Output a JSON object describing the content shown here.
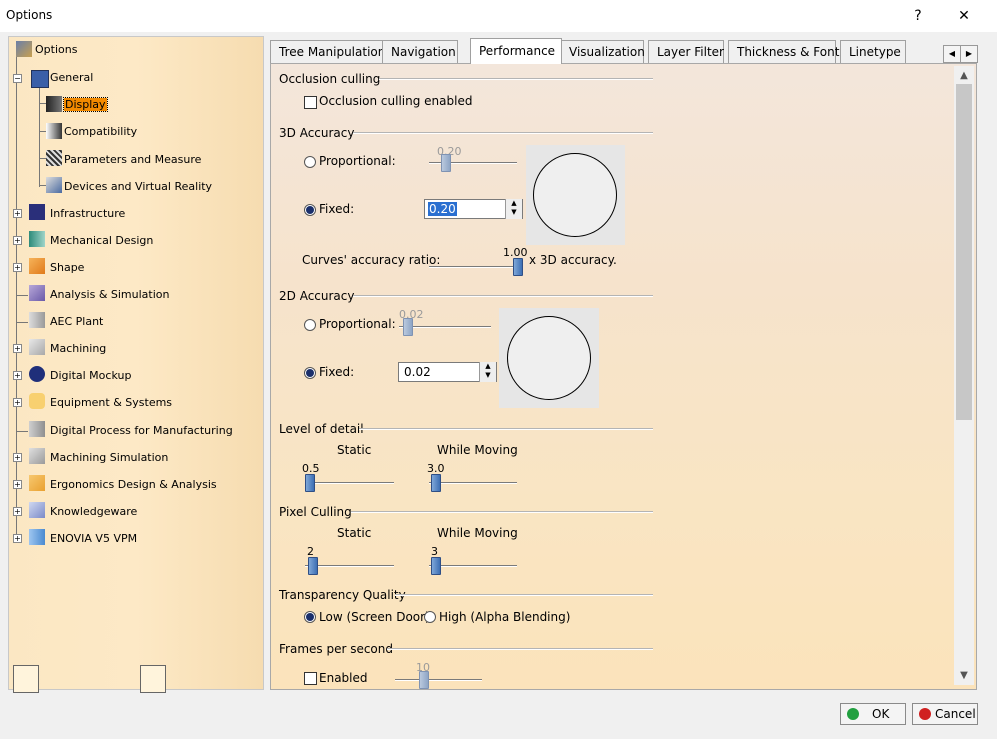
{
  "window": {
    "title": "Options",
    "help_label": "?",
    "close_label": "✕"
  },
  "tree": {
    "items": [
      {
        "label": "Options"
      },
      {
        "label": "General"
      },
      {
        "label": "Display"
      },
      {
        "label": "Compatibility"
      },
      {
        "label": "Parameters and Measure"
      },
      {
        "label": "Devices and Virtual Reality"
      },
      {
        "label": "Infrastructure"
      },
      {
        "label": "Mechanical Design"
      },
      {
        "label": "Shape"
      },
      {
        "label": "Analysis & Simulation"
      },
      {
        "label": "AEC Plant"
      },
      {
        "label": "Machining"
      },
      {
        "label": "Digital Mockup"
      },
      {
        "label": "Equipment & Systems"
      },
      {
        "label": "Digital Process for Manufacturing"
      },
      {
        "label": "Machining Simulation"
      },
      {
        "label": "Ergonomics Design & Analysis"
      },
      {
        "label": "Knowledgeware"
      },
      {
        "label": "ENOVIA V5 VPM"
      }
    ]
  },
  "tabs": [
    {
      "label": "Tree Manipulation"
    },
    {
      "label": "Navigation"
    },
    {
      "label": "Performance"
    },
    {
      "label": "Visualization"
    },
    {
      "label": "Layer Filter"
    },
    {
      "label": "Thickness & Font"
    },
    {
      "label": "Linetype"
    }
  ],
  "performance": {
    "occlusion": {
      "title": "Occlusion culling",
      "checkbox_label": "Occlusion culling enabled",
      "checked": false
    },
    "accuracy3d": {
      "title": "3D Accuracy",
      "proportional_label": "Proportional:",
      "proportional_value": "0.20",
      "fixed_label": "Fixed:",
      "fixed_value": "0.20",
      "curves_label": "Curves' accuracy ratio:",
      "curves_value": "1.00",
      "curves_suffix": "x 3D accuracy."
    },
    "accuracy2d": {
      "title": "2D Accuracy",
      "proportional_label": "Proportional:",
      "proportional_value": "0.02",
      "fixed_label": "Fixed:",
      "fixed_value": "0.02"
    },
    "lod": {
      "title": "Level of detail",
      "static_label": "Static",
      "moving_label": "While Moving",
      "static_value": "0.5",
      "moving_value": "3.0"
    },
    "pixel": {
      "title": "Pixel Culling",
      "static_label": "Static",
      "moving_label": "While Moving",
      "static_value": "2",
      "moving_value": "3"
    },
    "transparency": {
      "title": "Transparency Quality",
      "low_label": "Low (Screen Door)",
      "high_label": "High (Alpha Blending)"
    },
    "fps": {
      "title": "Frames per second",
      "enabled_label": "Enabled",
      "value": "10"
    }
  },
  "buttons": {
    "ok": "OK",
    "cancel": "Cancel"
  },
  "colors": {
    "tree_bg": "#fde9c6",
    "selection": "#f28a00",
    "ok_icon": "#22a040",
    "cancel_icon": "#d02020"
  }
}
